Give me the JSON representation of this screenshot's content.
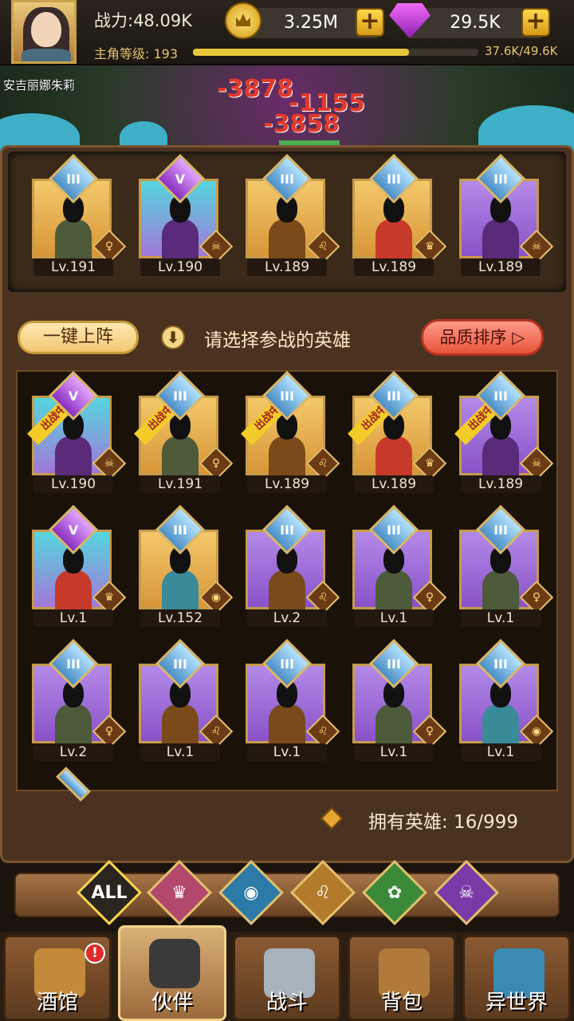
{
  "header": {
    "power": "战力:48.09K",
    "level_label": "主角等级: 193",
    "xp_text": "37.6K/49.6K",
    "xp_fraction": 0.758,
    "gold": "3.25M",
    "gems": "29.5K",
    "gold_plus": "+",
    "gem_plus": "+"
  },
  "scene": {
    "hero_name": "安吉丽娜朱莉",
    "damage": [
      "-3878",
      "-1155",
      "-3858"
    ]
  },
  "formation": [
    {
      "level": "Lv.191",
      "rank": "III",
      "bg": "gold",
      "cls": "elf"
    },
    {
      "level": "Lv.190",
      "rank": "V",
      "bg": "cyan",
      "cls": "demon"
    },
    {
      "level": "Lv.189",
      "rank": "III",
      "bg": "gold",
      "cls": "lion"
    },
    {
      "level": "Lv.189",
      "rank": "III",
      "bg": "gold",
      "cls": "crown"
    },
    {
      "level": "Lv.189",
      "rank": "III",
      "bg": "purple",
      "cls": "demon"
    }
  ],
  "controls": {
    "auto_deploy": "一键上阵",
    "hint": "请选择参战的英雄",
    "sort": "品质排序",
    "sort_arrow": "▷",
    "hint_icon": "⬇"
  },
  "roster": [
    {
      "level": "Lv.190",
      "rank": "V",
      "bg": "cyan",
      "cls": "demon",
      "deployed": true
    },
    {
      "level": "Lv.191",
      "rank": "III",
      "bg": "gold",
      "cls": "elf",
      "deployed": true
    },
    {
      "level": "Lv.189",
      "rank": "III",
      "bg": "gold",
      "cls": "lion",
      "deployed": true
    },
    {
      "level": "Lv.189",
      "rank": "III",
      "bg": "gold",
      "cls": "crown",
      "deployed": true
    },
    {
      "level": "Lv.189",
      "rank": "III",
      "bg": "purple",
      "cls": "demon",
      "deployed": true
    },
    {
      "level": "Lv.1",
      "rank": "V",
      "bg": "cyan",
      "cls": "crown",
      "deployed": false
    },
    {
      "level": "Lv.152",
      "rank": "III",
      "bg": "gold",
      "cls": "fish",
      "deployed": false
    },
    {
      "level": "Lv.2",
      "rank": "III",
      "bg": "purple",
      "cls": "lion",
      "deployed": false
    },
    {
      "level": "Lv.1",
      "rank": "III",
      "bg": "purple",
      "cls": "elf",
      "deployed": false
    },
    {
      "level": "Lv.1",
      "rank": "III",
      "bg": "purple",
      "cls": "elf",
      "deployed": false
    },
    {
      "level": "Lv.2",
      "rank": "III",
      "bg": "purple",
      "cls": "elf",
      "deployed": false
    },
    {
      "level": "Lv.1",
      "rank": "III",
      "bg": "purple",
      "cls": "lion",
      "deployed": false
    },
    {
      "level": "Lv.1",
      "rank": "III",
      "bg": "purple",
      "cls": "lion",
      "deployed": false
    },
    {
      "level": "Lv.1",
      "rank": "III",
      "bg": "purple",
      "cls": "elf",
      "deployed": false
    },
    {
      "level": "Lv.1",
      "rank": "III",
      "bg": "purple",
      "cls": "fish",
      "deployed": false
    }
  ],
  "deployed_ribbon": "出战中",
  "owned": "拥有英雄: 16/999",
  "filters": [
    {
      "label": "ALL",
      "icon": "all-icon"
    },
    {
      "label": "♛",
      "icon": "crown-class-icon"
    },
    {
      "label": "◉",
      "icon": "fish-class-icon"
    },
    {
      "label": "♌",
      "icon": "lion-class-icon"
    },
    {
      "label": "✿",
      "icon": "elf-class-icon"
    },
    {
      "label": "☠",
      "icon": "demon-class-icon"
    }
  ],
  "nav": [
    {
      "label": "酒馆",
      "icon": "tavern-mug-icon"
    },
    {
      "label": "伙伴",
      "icon": "partner-icon"
    },
    {
      "label": "战斗",
      "icon": "battle-swords-icon"
    },
    {
      "label": "背包",
      "icon": "backpack-icon"
    },
    {
      "label": "异世界",
      "icon": "portal-icon"
    }
  ],
  "nav_alert": "!",
  "colors": {
    "gold_card": "#f3c86a",
    "purple_card": "#b28ae8",
    "cyan_card": "#54d6de",
    "sort_button": "#e8543a",
    "xp_fill": "#e6c63a"
  }
}
